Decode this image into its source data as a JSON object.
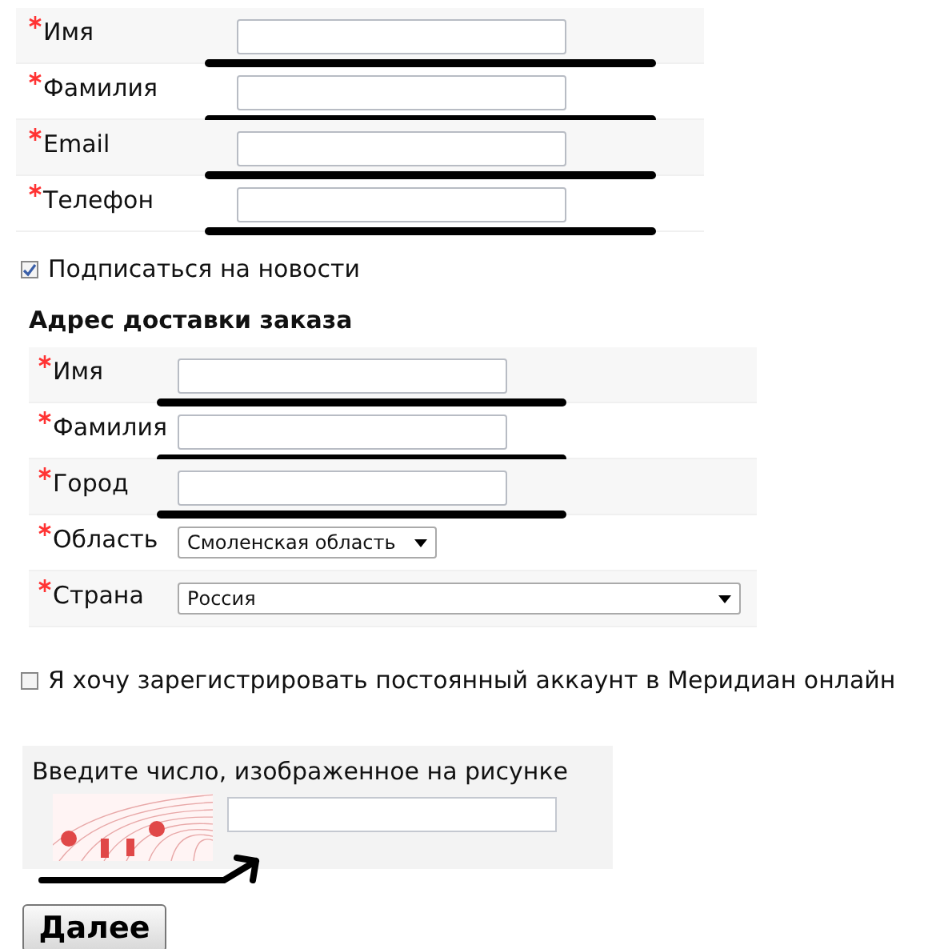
{
  "contact_fields": [
    {
      "label": "Имя",
      "required": true,
      "kind": "text"
    },
    {
      "label": "Фамилия",
      "required": true,
      "kind": "text"
    },
    {
      "label": "Email",
      "required": true,
      "kind": "text"
    },
    {
      "label": "Телефон",
      "required": true,
      "kind": "text"
    }
  ],
  "newsletter": {
    "label": "Подписаться на новости",
    "checked": true
  },
  "delivery": {
    "title": "Адрес доставки заказа",
    "fields": [
      {
        "label": "Имя",
        "required": true,
        "kind": "text"
      },
      {
        "label": "Фамилия",
        "required": true,
        "kind": "text"
      },
      {
        "label": "Город",
        "required": true,
        "kind": "text"
      },
      {
        "label": "Область",
        "required": true,
        "kind": "select",
        "value": "Смоленская область"
      },
      {
        "label": "Страна",
        "required": true,
        "kind": "select",
        "value": "Россия"
      }
    ]
  },
  "register": {
    "label": "Я хочу зарегистрировать постоянный аккаунт в Меридиан онлайн",
    "checked": false
  },
  "captcha": {
    "label": "Введите число, изображенное на рисунке"
  },
  "next_button": "Далее"
}
